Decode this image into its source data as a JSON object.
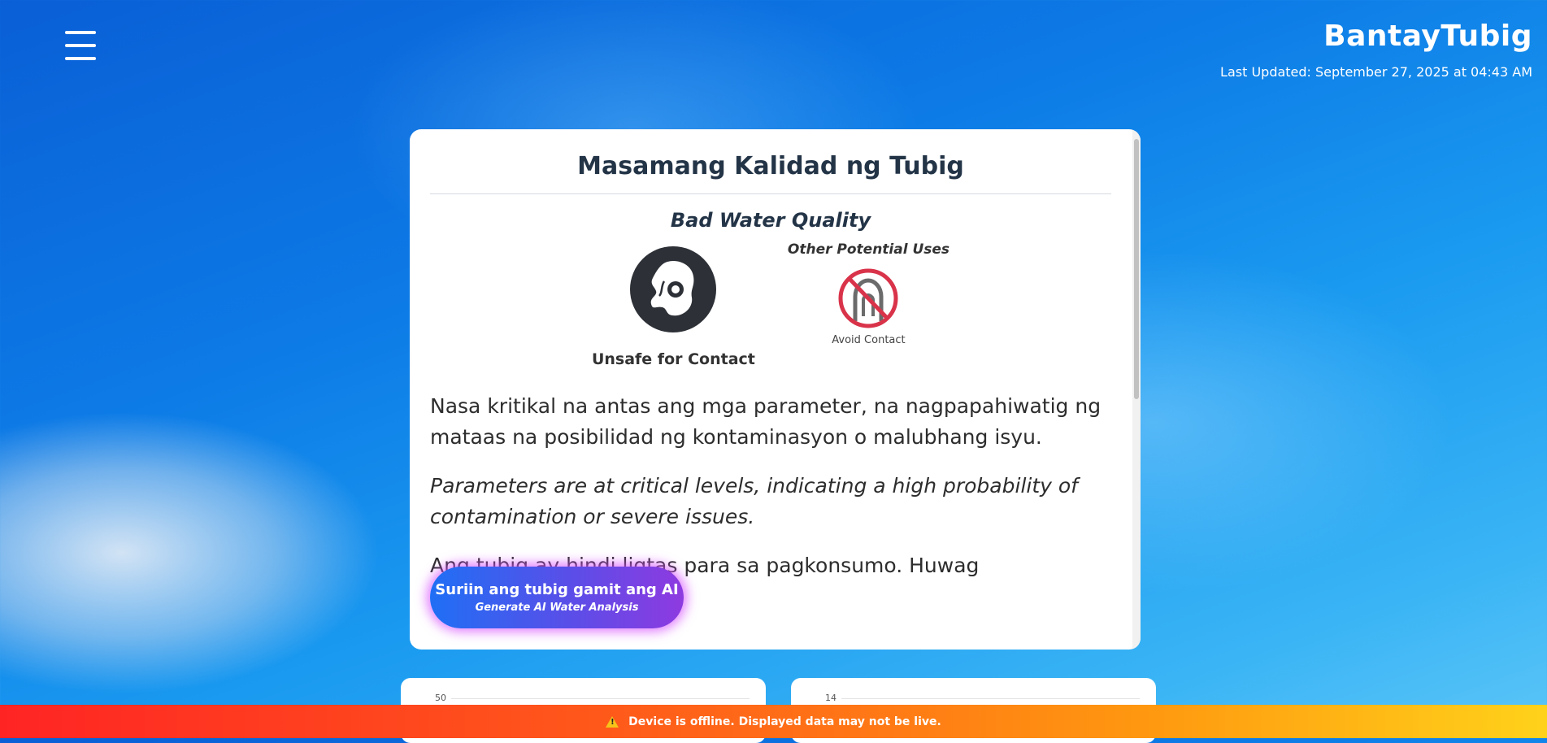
{
  "header": {
    "brand": "BantayTubig",
    "last_updated": "Last Updated: September 27, 2025 at 04:43 AM"
  },
  "status_card": {
    "title_tl": "Masamang Kalidad ng Tubig",
    "title_en": "Bad Water Quality",
    "primary_icon": "unsafe-contact-icon",
    "primary_label": "Unsafe for Contact",
    "other_uses_label": "Other Potential Uses",
    "avoid_icon": "avoid-contact-icon",
    "avoid_label": "Avoid Contact",
    "desc_tl": "Nasa kritikal na antas ang mga parameter, na nagpapahiwatig ng mataas na posibilidad ng kontaminasyon o malubhang isyu.",
    "desc_en": "Parameters are at critical levels, indicating a high probability of contamination or severe issues.",
    "desc_tl_2": "Ang tubig ay hindi ligtas para sa pagkonsumo. Huwag"
  },
  "ai_button": {
    "label_tl": "Suriin ang tubig gamit ang AI",
    "label_en": "Generate AI Water Analysis"
  },
  "charts": [
    {
      "top_tick": "50"
    },
    {
      "top_tick": "14"
    }
  ],
  "offline_banner": {
    "icon": "warning-icon",
    "text": "Device is offline. Displayed data may not be live."
  },
  "colors": {
    "ai_button_start": "#1f6ff5",
    "ai_button_end": "#8e3ae0",
    "banner_start": "#ff2424",
    "banner_end": "#ffd21a",
    "avoid_icon_red": "#d9334a"
  }
}
